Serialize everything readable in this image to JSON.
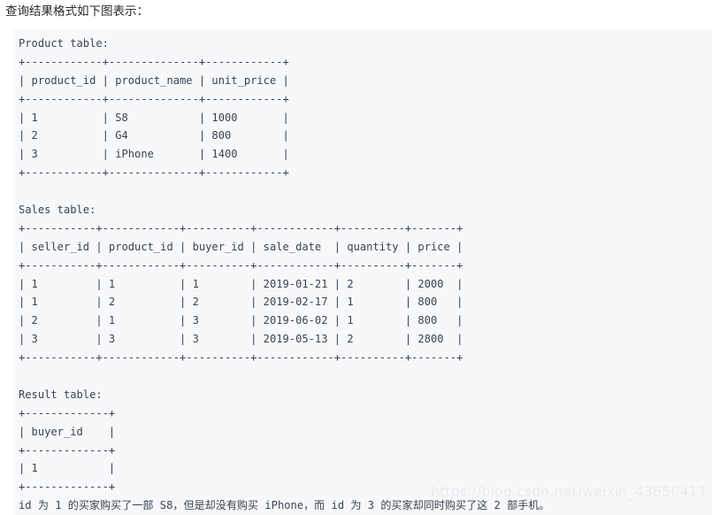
{
  "intro": {
    "text": "查询结果格式如下图表示："
  },
  "code_block": {
    "background_color": "#f7f8fa",
    "text_color": "#3b4351",
    "lines": [
      "Product table:",
      "+------------+--------------+------------+",
      "| product_id | product_name | unit_price |",
      "+------------+--------------+------------+",
      "| 1          | S8           | 1000       |",
      "| 2          | G4           | 800        |",
      "| 3          | iPhone       | 1400       |",
      "+------------+--------------+------------+",
      "",
      "Sales table:",
      "+-----------+------------+----------+------------+----------+-------+",
      "| seller_id | product_id | buyer_id | sale_date  | quantity | price |",
      "+-----------+------------+----------+------------+----------+-------+",
      "| 1         | 1          | 1        | 2019-01-21 | 2        | 2000  |",
      "| 1         | 2          | 2        | 2019-02-17 | 1        | 800   |",
      "| 2         | 1          | 3        | 2019-06-02 | 1        | 800   |",
      "| 3         | 3          | 3        | 2019-05-13 | 2        | 2800  |",
      "+-----------+------------+----------+------------+----------+-------+",
      "",
      "Result table:",
      "+-------------+",
      "| buyer_id    |",
      "+-------------+",
      "| 1           |",
      "+-------------+"
    ],
    "caption": "id 为 1 的买家购买了一部 S8，但是却没有购买 iPhone，而 id 为 3 的买家却同时购买了这 2 部手机。"
  },
  "tables": {
    "product": {
      "name": "Product table",
      "columns": [
        "product_id",
        "product_name",
        "unit_price"
      ],
      "rows": [
        [
          "1",
          "S8",
          "1000"
        ],
        [
          "2",
          "G4",
          "800"
        ],
        [
          "3",
          "iPhone",
          "1400"
        ]
      ]
    },
    "sales": {
      "name": "Sales table",
      "columns": [
        "seller_id",
        "product_id",
        "buyer_id",
        "sale_date",
        "quantity",
        "price"
      ],
      "rows": [
        [
          "1",
          "1",
          "1",
          "2019-01-21",
          "2",
          "2000"
        ],
        [
          "1",
          "2",
          "2",
          "2019-02-17",
          "1",
          "800"
        ],
        [
          "2",
          "1",
          "3",
          "2019-06-02",
          "1",
          "800"
        ],
        [
          "3",
          "3",
          "3",
          "2019-05-13",
          "2",
          "2800"
        ]
      ]
    },
    "result": {
      "name": "Result table",
      "columns": [
        "buyer_id"
      ],
      "rows": [
        [
          "1"
        ]
      ]
    }
  },
  "watermark": {
    "text": "https://blog.csdn.net/weixin_43650411",
    "color": "#ececef"
  }
}
